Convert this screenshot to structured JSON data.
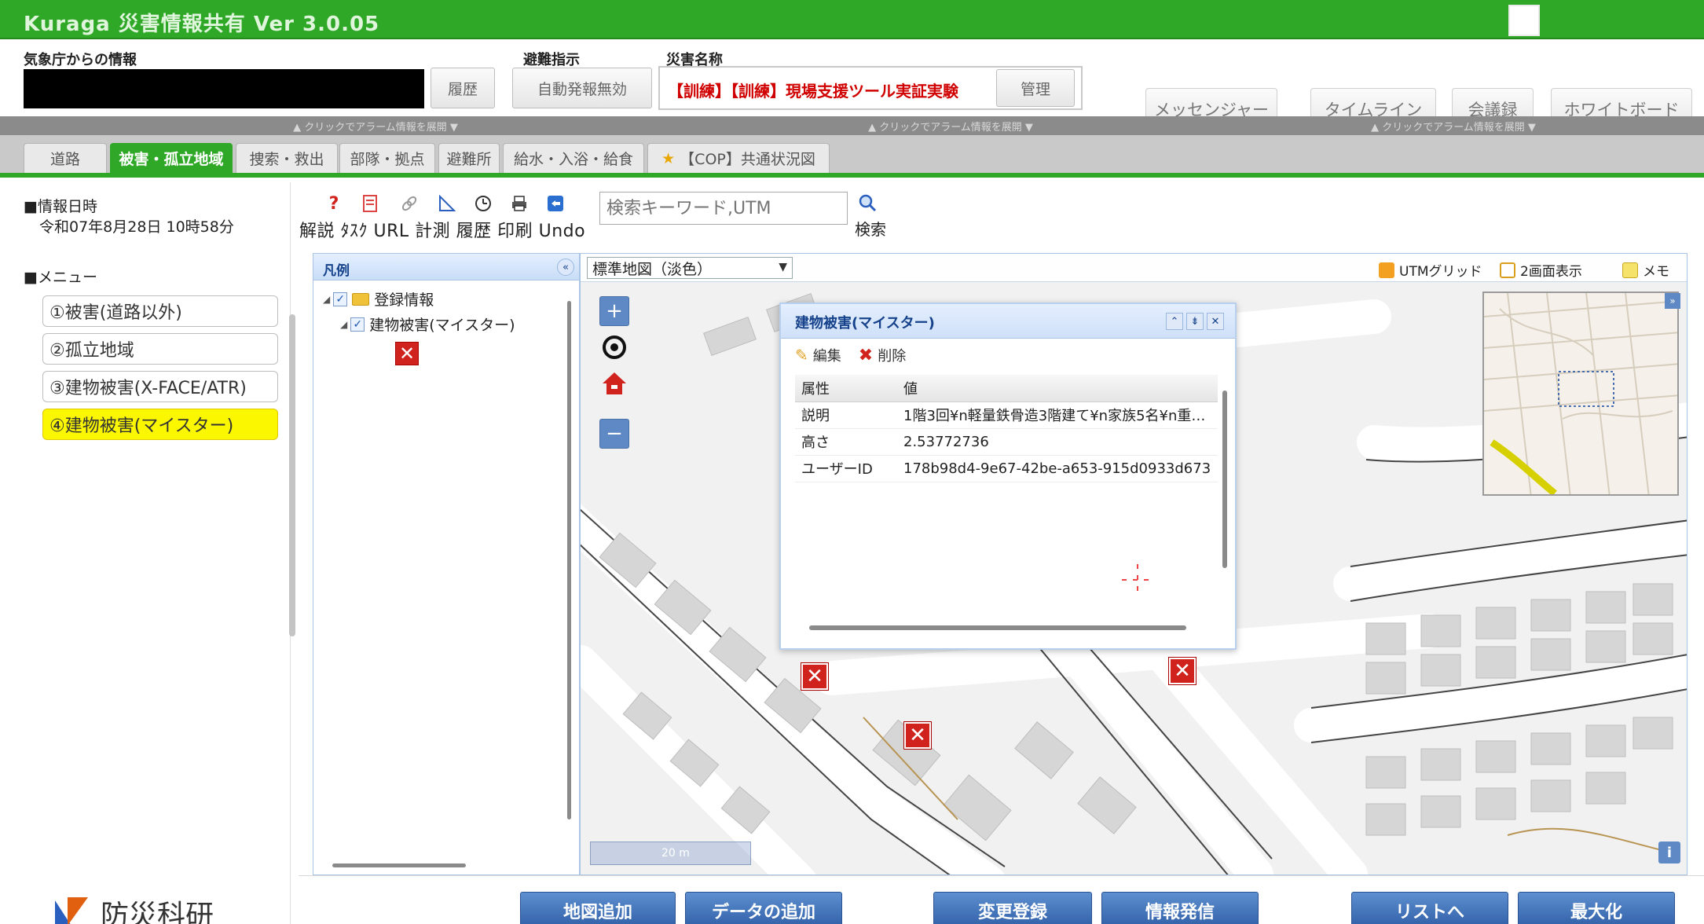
{
  "app": {
    "title": "Kuraga 災害情報共有 Ver 3.0.05"
  },
  "header": {
    "jma_label": "気象庁からの情報",
    "evac_label": "避難指示",
    "disaster_label": "災害名称",
    "history_button": "履歴",
    "auto_alert_button": "自動発報無効",
    "disaster_name": "【訓練】【訓練】現場支援ツール実証実験",
    "manage_button": "管理",
    "right_buttons": [
      "メッセンジャー",
      "タイムライン",
      "会議録",
      "ホワイトボード"
    ]
  },
  "alarm_bar": {
    "segments": [
      "▲ クリックでアラーム情報を展開 ▼",
      "▲ クリックでアラーム情報を展開 ▼",
      "▲ クリックでアラーム情報を展開 ▼"
    ]
  },
  "tabs": [
    {
      "label": "道路"
    },
    {
      "label": "被害・孤立地域",
      "active": true
    },
    {
      "label": "捜索・救出"
    },
    {
      "label": "部隊・拠点"
    },
    {
      "label": "避難所"
    },
    {
      "label": "給水・入浴・給食"
    },
    {
      "label": "【COP】共通状況図",
      "starred": true
    }
  ],
  "sidebar": {
    "datetime_label": "■情報日時",
    "datetime_value": "令和07年8月28日 10時58分",
    "menu_label": "■メニュー",
    "menu_items": [
      {
        "label": "①被害(道路以外)"
      },
      {
        "label": "②孤立地域"
      },
      {
        "label": "③建物被害(X-FACE/ATR)"
      },
      {
        "label": "④建物被害(マイスター)",
        "selected": true
      }
    ],
    "logo_text": "防災科研"
  },
  "toolbar": {
    "tool_labels": "解説 ﾀｽｸ URL 計測 履歴 印刷 Undo",
    "search_placeholder": "検索キーワード,UTM",
    "search_label": "検索"
  },
  "legend": {
    "title": "凡例",
    "root_node": "登録情報",
    "child_node": "建物被害(マイスター)"
  },
  "map": {
    "basemap": "標準地図（淡色）",
    "utm_grid": "UTMグリッド",
    "dual_view": "2画面表示",
    "memo": "メモ",
    "scale_text": "20 m"
  },
  "popup": {
    "title": "建物被害(マイスター)",
    "edit": "編集",
    "delete": "削除",
    "col_attr": "属性",
    "col_value": "値",
    "rows": [
      {
        "key": "説明",
        "value": "1階3回¥n軽量鉄骨造3階建て¥n家族5名¥n重…"
      },
      {
        "key": "高さ",
        "value": "2.53772736"
      },
      {
        "key": "ユーザーID",
        "value": "178b98d4-9e67-42be-a653-915d0933d673"
      }
    ]
  },
  "bottom_buttons": [
    "地図追加",
    "データの追加",
    "変更登録",
    "情報発信",
    "リストへ",
    "最大化"
  ]
}
